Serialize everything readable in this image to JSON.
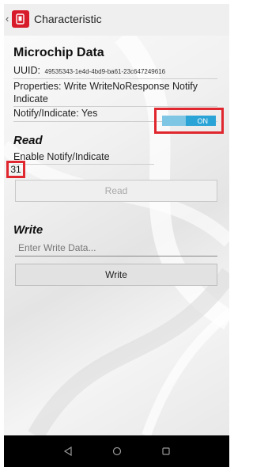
{
  "appbar": {
    "title": "Characteristic"
  },
  "info": {
    "heading": "Microchip Data",
    "uuid_label": "UUID:",
    "uuid_value": "49535343-1e4d-4bd9-ba61-23c647249616",
    "properties": "Properties: Write WriteNoResponse Notify Indicate",
    "notify": "Notify/Indicate: Yes"
  },
  "read": {
    "heading": "Read",
    "enable_label": "Enable Notify/Indicate",
    "toggle_state": "ON",
    "value": "31",
    "button_label": "Read"
  },
  "write": {
    "heading": "Write",
    "placeholder": "Enter Write Data...",
    "button_label": "Write"
  },
  "colors": {
    "brand": "#d81b2b",
    "toggle_on": "#2aa3d6",
    "highlight": "#e0262e"
  }
}
